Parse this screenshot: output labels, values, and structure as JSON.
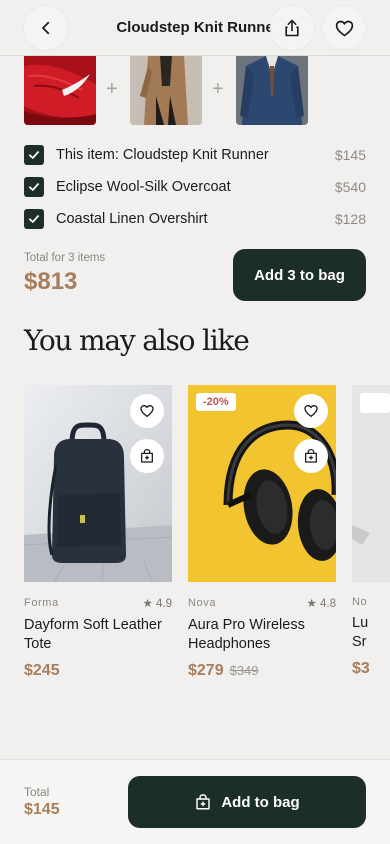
{
  "header": {
    "title": "Cloudstep Knit Runner"
  },
  "bundle": {
    "plus": "+",
    "items": [
      {
        "label": "This item: Cloudstep Knit Runner",
        "price": "$145",
        "checked": true
      },
      {
        "label": "Eclipse Wool-Silk Overcoat",
        "price": "$540",
        "checked": true
      },
      {
        "label": "Coastal Linen Overshirt",
        "price": "$128",
        "checked": true
      }
    ],
    "total_label": "Total for 3 items",
    "total_value": "$813",
    "button_label": "Add 3 to bag"
  },
  "recommendations": {
    "title": "You may also like",
    "items": [
      {
        "brand": "Forma",
        "rating": "4.9",
        "name_line1": "Dayform Soft Leather",
        "name_line2": "Tote",
        "price": "$245",
        "old_price": ""
      },
      {
        "brand": "Nova",
        "rating": "4.8",
        "name_line1": "Aura Pro Wireless",
        "name_line2": "Headphones",
        "price": "$279",
        "old_price": "$349",
        "badge": "-20%"
      },
      {
        "brand": "No",
        "rating": "",
        "name_line1": "Lu",
        "name_line2": "Sr",
        "price": "$3",
        "old_price": ""
      }
    ]
  },
  "bottom_bar": {
    "total_label": "Total",
    "total_value": "$145",
    "button_label": "Add to bag"
  },
  "colors": {
    "accent": "#a67e5b",
    "primary": "#1c2e2a",
    "background": "#f2f0ee"
  }
}
